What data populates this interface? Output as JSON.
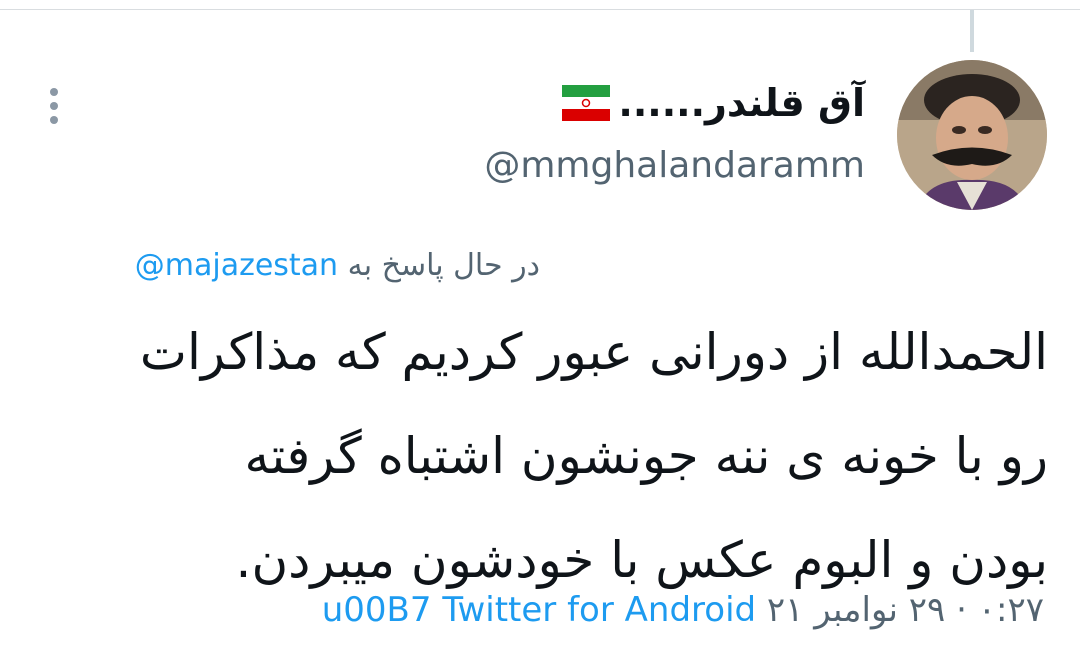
{
  "author": {
    "display_name": "آق قلندر......",
    "handle": "@mmghalandaramm",
    "flag_icon": "iran-flag-icon",
    "avatar": "profile-photo"
  },
  "reply_context": {
    "prefix": "در حال پاسخ به",
    "target": "@majazestan"
  },
  "tweet": {
    "lines": [
      "الحمدالله از دورانی عبور کردیم که مذاکرات",
      "رو با خونه ی ننه جونشون اشتباه گرفته",
      "بودن و البوم عکس با خودشون میبردن."
    ]
  },
  "meta": {
    "time": "۰:۲۷",
    "separator": "·",
    "date": "۲۹ نوامبر ۲۱",
    "mark": "u00B7",
    "source": "Twitter for Android"
  },
  "icons": {
    "more": "more-vertical-icon"
  },
  "colors": {
    "link": "#1d9bf0",
    "secondary_text": "#536471",
    "primary_text": "#0f1419"
  }
}
